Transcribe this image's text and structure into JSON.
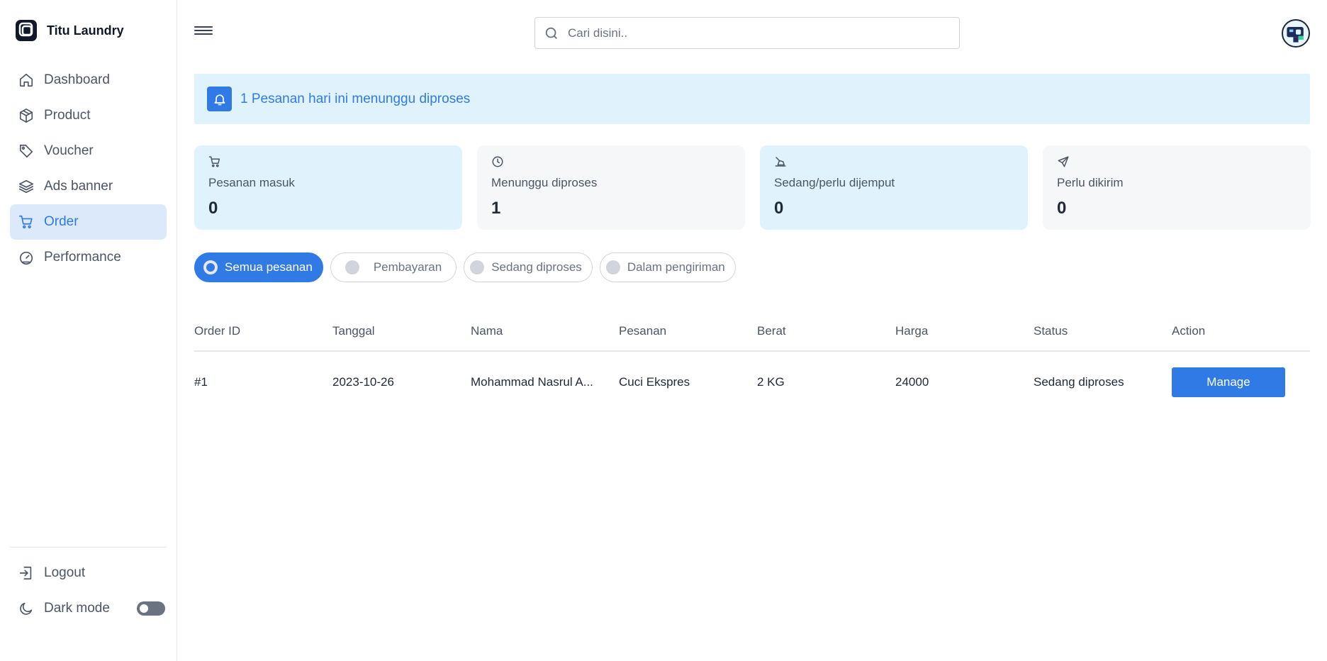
{
  "app": {
    "name": "Titu Laundry"
  },
  "sidebar": {
    "items": [
      {
        "label": "Dashboard",
        "icon": "home-icon"
      },
      {
        "label": "Product",
        "icon": "box-icon"
      },
      {
        "label": "Voucher",
        "icon": "tag-icon"
      },
      {
        "label": "Ads banner",
        "icon": "layers-icon"
      },
      {
        "label": "Order",
        "icon": "cart-icon",
        "active": true
      },
      {
        "label": "Performance",
        "icon": "gauge-icon"
      }
    ],
    "logout_label": "Logout",
    "dark_mode_label": "Dark mode",
    "dark_mode_on": false
  },
  "header": {
    "search_placeholder": "Cari disini.."
  },
  "alert": {
    "text": "1 Pesanan hari ini menunggu diproses"
  },
  "stats": [
    {
      "label": "Pesanan masuk",
      "value": "0",
      "icon": "cart-icon"
    },
    {
      "label": "Menunggu diproses",
      "value": "1",
      "icon": "clock-icon"
    },
    {
      "label": "Sedang/perlu dijemput",
      "value": "0",
      "icon": "pickup-icon"
    },
    {
      "label": "Perlu dikirim",
      "value": "0",
      "icon": "plane-icon"
    }
  ],
  "filters": [
    {
      "label": "Semua pesanan",
      "active": true
    },
    {
      "label": "Pembayaran",
      "active": false
    },
    {
      "label": "Sedang diproses",
      "active": false
    },
    {
      "label": "Dalam pengiriman",
      "active": false
    }
  ],
  "table": {
    "headers": [
      "Order ID",
      "Tanggal",
      "Nama",
      "Pesanan",
      "Berat",
      "Harga",
      "Status",
      "Action"
    ],
    "rows": [
      {
        "order_id": "#1",
        "tanggal": "2023-10-26",
        "nama": "Mohammad Nasrul A...",
        "pesanan": "Cuci Ekspres",
        "berat": "2 KG",
        "harga": "24000",
        "status": "Sedang diproses",
        "action": "Manage"
      }
    ]
  },
  "colors": {
    "accent": "#2f7ae5",
    "active_nav_bg": "#dbe9fb",
    "alert_bg": "#e0f3fc",
    "card_gray": "#f5f7f9"
  }
}
